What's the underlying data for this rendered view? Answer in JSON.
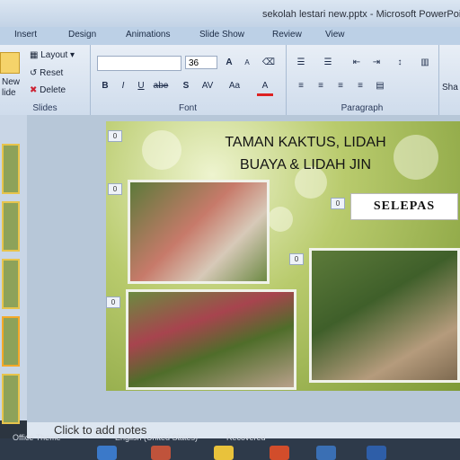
{
  "window": {
    "title": "sekolah lestari new.pptx - Microsoft PowerPoint"
  },
  "tabs": [
    "Insert",
    "Design",
    "Animations",
    "Slide Show",
    "Review",
    "View"
  ],
  "ribbon": {
    "slides_group": {
      "label": "Slides",
      "new_label": "New",
      "slide_label": "lide",
      "layout": "Layout",
      "reset": "Reset",
      "delete": "Delete"
    },
    "font_group": {
      "label": "Font",
      "size": "36",
      "grow": "A",
      "shrink": "A",
      "bold": "B",
      "italic": "I",
      "underline": "U",
      "strike": "abe",
      "shadow": "S",
      "spacing": "AV",
      "case": "Aa",
      "color": "A"
    },
    "paragraph_group": {
      "label": "Paragraph"
    },
    "drawing_group": {
      "shape_label": "Sha"
    }
  },
  "slide": {
    "title_line1": "TAMAN KAKTUS, LIDAH",
    "title_line2": "BUAYA & LIDAH JIN",
    "button_label": "SELEPAS",
    "markers": [
      "0",
      "0",
      "0",
      "0",
      "0"
    ]
  },
  "notes": {
    "placeholder": "Click to add notes"
  },
  "status": {
    "theme": "Office Theme",
    "language": "English (United States)",
    "state": "Recovered"
  },
  "colors": {
    "ribbon": "#dbe5f1",
    "slide_bg": "#a8bf5a",
    "accent": "#2a5ba8"
  }
}
